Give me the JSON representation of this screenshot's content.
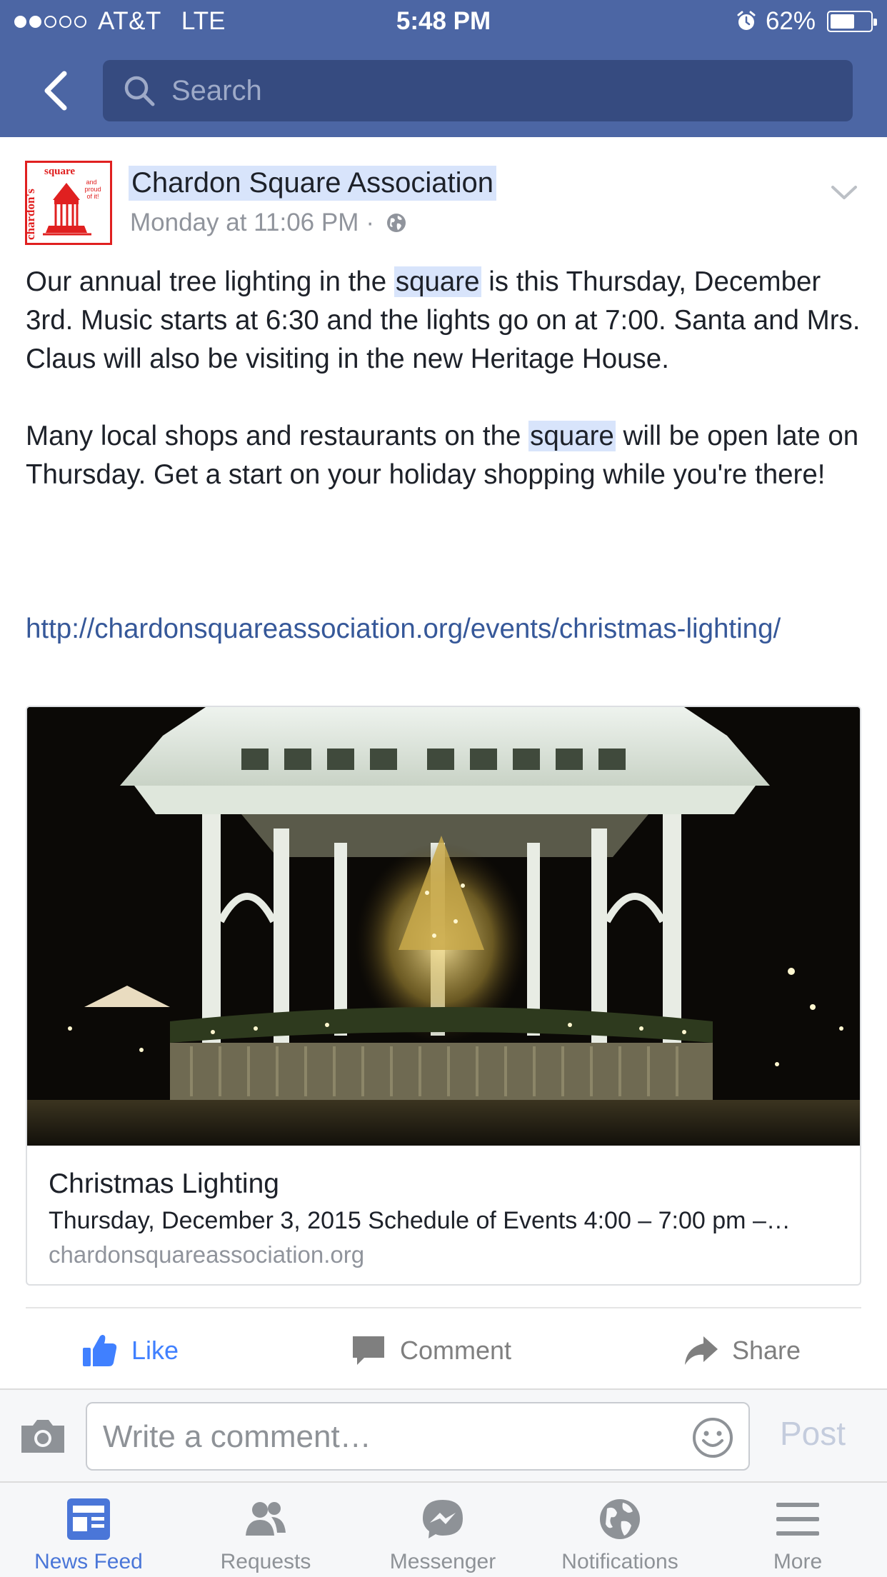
{
  "status_bar": {
    "carrier": "AT&T",
    "network": "LTE",
    "time": "5:48 PM",
    "battery": "62%",
    "battery_level": 0.62,
    "signal_bars": 2,
    "signal_total": 5
  },
  "nav": {
    "search_placeholder": "Search"
  },
  "post": {
    "author": "Chardon Square Association",
    "timestamp": "Monday at 11:06 PM",
    "separator": "·",
    "logo_text": [
      "chardon's",
      "square",
      "and proud of it!"
    ],
    "paragraph1": {
      "before": "Our annual tree lighting in the ",
      "highlight": "square",
      "after": " is this Thursday, December 3rd. Music starts at 6:30 and the lights go on at 7:00. Santa and Mrs. Claus will also be visiting in the new Heritage House."
    },
    "paragraph2": {
      "before": "Many local shops and restaurants on the ",
      "highlight": "square",
      "after": " will be open late on Thursday. Get a start on your holiday shopping while you're there!"
    },
    "link": "http://chardonsquareassociation.org/events/christmas-lighting/"
  },
  "card": {
    "title": "Christmas Lighting",
    "description": "Thursday, December 3, 2015 Schedule of Events 4:00 – 7:00 pm –…",
    "domain": "chardonsquareassociation.org"
  },
  "actions": {
    "like": "Like",
    "comment": "Comment",
    "share": "Share"
  },
  "composer": {
    "placeholder": "Write a comment…",
    "post_label": "Post"
  },
  "tabs": [
    {
      "label": "News Feed",
      "icon": "news-feed-icon",
      "active": true
    },
    {
      "label": "Requests",
      "icon": "friend-requests-icon",
      "active": false
    },
    {
      "label": "Messenger",
      "icon": "messenger-icon",
      "active": false
    },
    {
      "label": "Notifications",
      "icon": "globe-icon",
      "active": false
    },
    {
      "label": "More",
      "icon": "menu-icon",
      "active": false
    }
  ],
  "colors": {
    "brand_blue": "#4c66a4",
    "search_bg": "#364b80",
    "link_blue": "#365899",
    "like_blue": "#4080ff",
    "highlight": "#d8e4fb",
    "logo_red": "#e02020"
  }
}
